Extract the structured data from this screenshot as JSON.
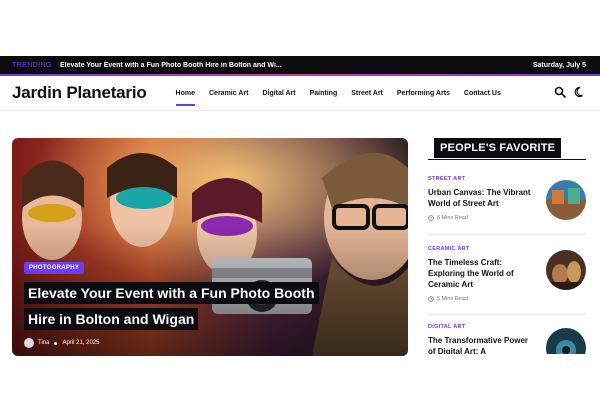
{
  "topbar": {
    "trending_label": "TRENDING",
    "ticker_text": "Elevate Your Event with a Fun Photo Booth Hire in Bolton and Wi...",
    "date": "Saturday, July 5"
  },
  "header": {
    "logo": "Jardin Planetario",
    "nav": [
      "Home",
      "Ceramic Art",
      "Digital Art",
      "Painting",
      "Street Art",
      "Performing Arts",
      "Contact Us"
    ],
    "active_nav": "Home",
    "icons": [
      "search-icon",
      "dark-mode-icon"
    ]
  },
  "hero": {
    "category": "PHOTOGRAPHY",
    "title_line1": "Elevate Your Event with a Fun Photo Booth",
    "title_line2": "Hire in Bolton and Wigan",
    "author": "Tina",
    "date": "April 21, 2025"
  },
  "sidebar": {
    "heading": "PEOPLE'S FAVORITE",
    "cards": [
      {
        "category": "STREET ART",
        "title": "Urban Canvas: The Vibrant World of Street Art",
        "read": "6 Mins Read"
      },
      {
        "category": "CERAMIC ART",
        "title": "The Timeless Craft: Exploring the World of Ceramic Art",
        "read": "5 Mins Read"
      },
      {
        "category": "DIGITAL ART",
        "title": "The Transformative Power of Digital Art: A",
        "read": ""
      }
    ]
  },
  "colors": {
    "accent": "#6b3cf0",
    "dark": "#0b0b10"
  }
}
